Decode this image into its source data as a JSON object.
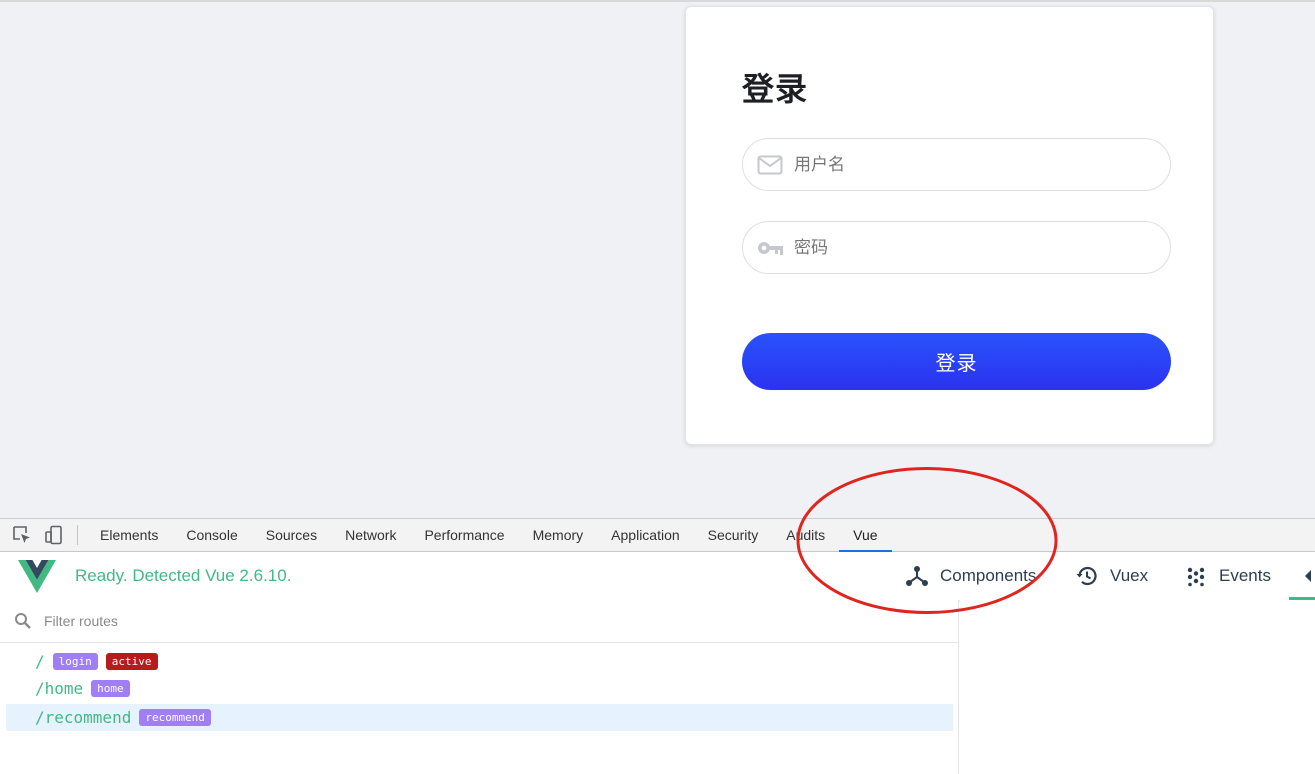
{
  "login": {
    "title": "登录",
    "username_placeholder": "用户名",
    "password_placeholder": "密码",
    "submit_label": "登录"
  },
  "devtools": {
    "tabs": [
      "Elements",
      "Console",
      "Sources",
      "Network",
      "Performance",
      "Memory",
      "Application",
      "Security",
      "Audits",
      "Vue"
    ],
    "active_tab": "Vue"
  },
  "vue": {
    "status": "Ready. Detected Vue 2.6.10.",
    "nav": {
      "components": "Components",
      "vuex": "Vuex",
      "events": "Events"
    },
    "filter_placeholder": "Filter routes",
    "routes": [
      {
        "path": "/",
        "name": "login",
        "active_tag": "active"
      },
      {
        "path": "/home",
        "name": "home"
      },
      {
        "path": "/recommend",
        "name": "recommend"
      }
    ]
  },
  "colors": {
    "vue_green": "#42b983",
    "login_button": "#2b3df5",
    "annotation_circle": "#e0251f",
    "route_tag": "#a07ef5",
    "active_tag": "#b71c1c"
  },
  "icons": {
    "username": "envelope-icon",
    "password": "key-icon",
    "components": "tree-icon",
    "vuex": "history-icon",
    "events": "dots-icon",
    "filter": "search-icon"
  }
}
